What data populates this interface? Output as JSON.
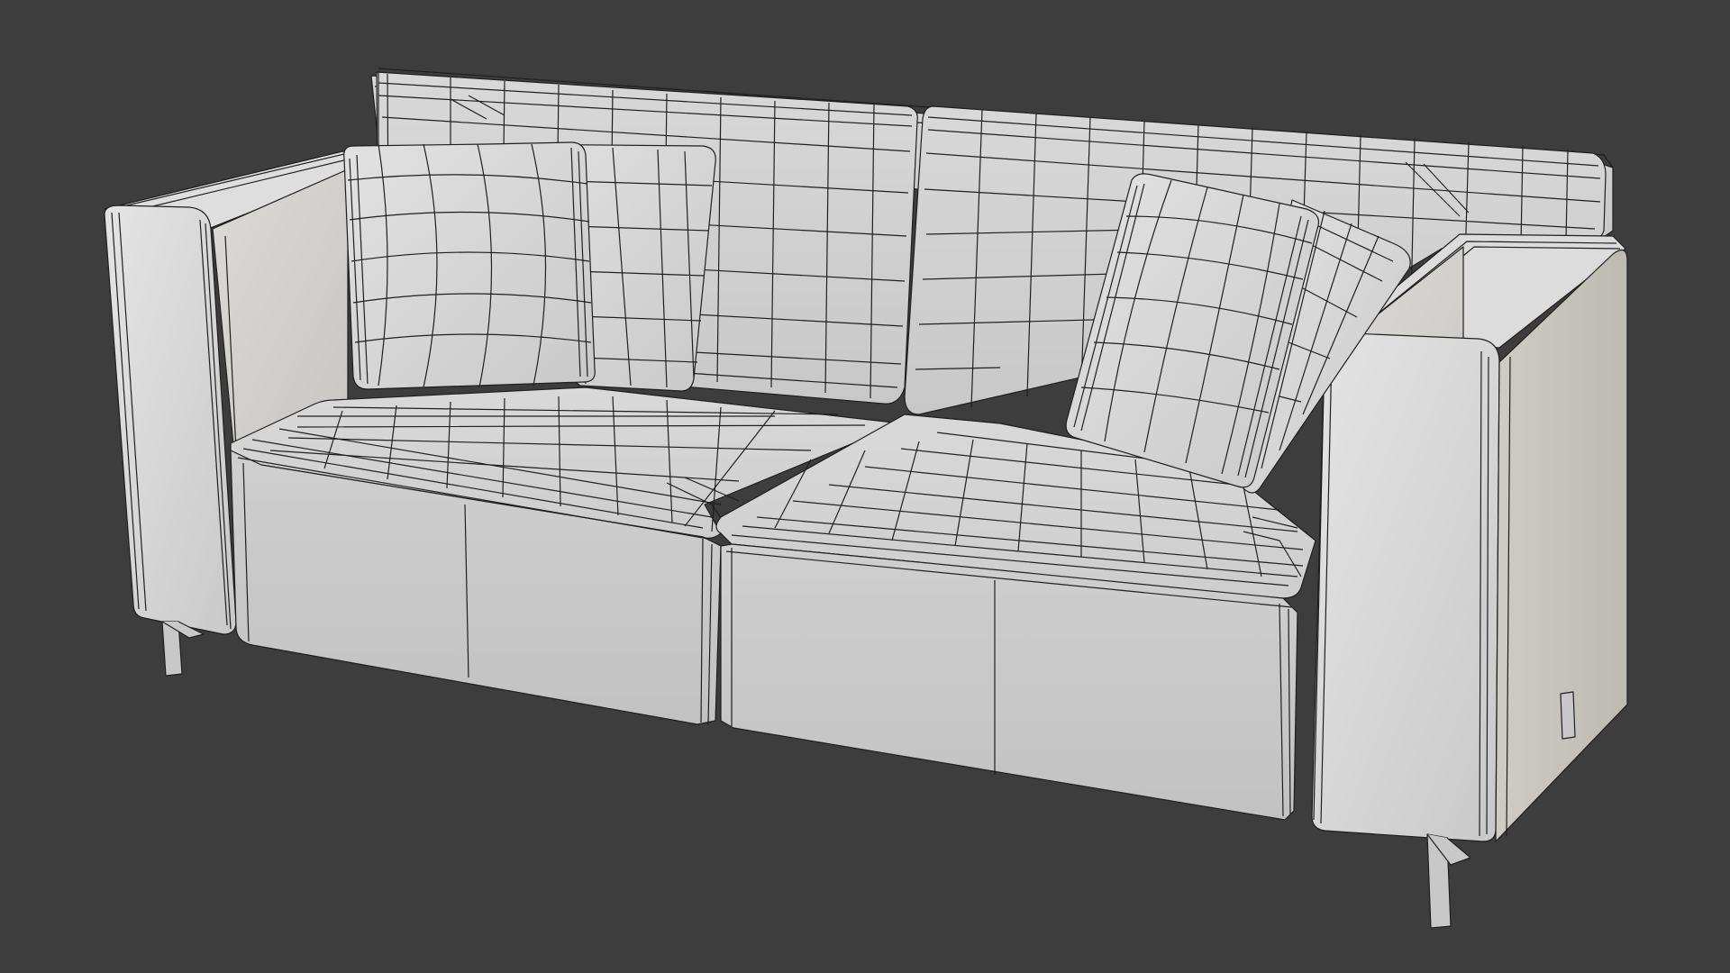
{
  "scene": {
    "background_color": "#3d3d3d",
    "subject": "sofa",
    "shading": "solid-wireframe",
    "surface_color": "#d6d6d6",
    "wire_color": "#1f1f1f"
  }
}
